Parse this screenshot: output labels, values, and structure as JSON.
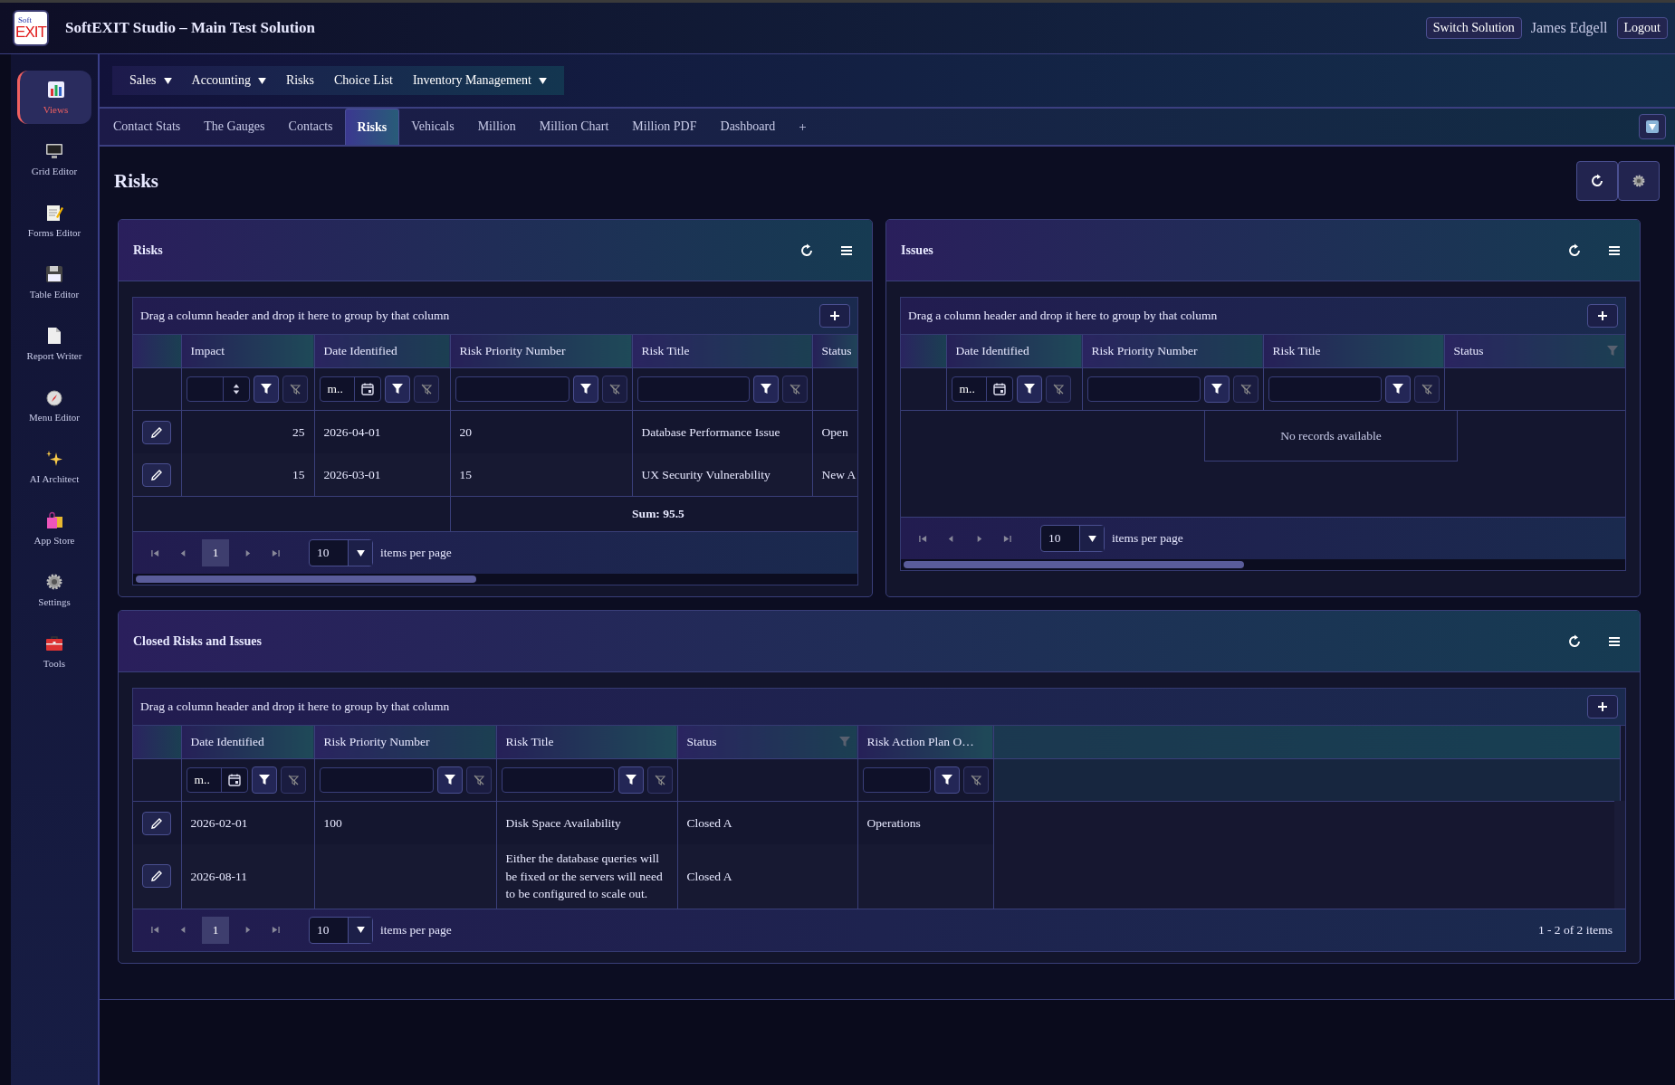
{
  "header": {
    "logo": {
      "top": "Soft",
      "bottom": "EXIT"
    },
    "title": "SoftEXIT Studio – Main Test Solution",
    "switch_button": "Switch Solution",
    "user": "James Edgell",
    "logout_button": "Logout"
  },
  "sidebar": {
    "items": [
      {
        "label": "Views",
        "selected": true
      },
      {
        "label": "Grid Editor",
        "selected": false
      },
      {
        "label": "Forms Editor",
        "selected": false
      },
      {
        "label": "Table Editor",
        "selected": false
      },
      {
        "label": "Report Writer",
        "selected": false
      },
      {
        "label": "Menu Editor",
        "selected": false
      },
      {
        "label": "AI Architect",
        "selected": false
      },
      {
        "label": "App Store",
        "selected": false
      },
      {
        "label": "Settings",
        "selected": false
      },
      {
        "label": "Tools",
        "selected": false
      }
    ]
  },
  "menu": {
    "items": [
      {
        "label": "Sales",
        "has_submenu": true
      },
      {
        "label": "Accounting",
        "has_submenu": true
      },
      {
        "label": "Risks",
        "has_submenu": false
      },
      {
        "label": "Choice List",
        "has_submenu": false
      },
      {
        "label": "Inventory Management",
        "has_submenu": true
      }
    ]
  },
  "tabs": {
    "items": [
      {
        "label": "Contact Stats",
        "selected": false
      },
      {
        "label": "The Gauges",
        "selected": false
      },
      {
        "label": "Contacts",
        "selected": false
      },
      {
        "label": "Risks",
        "selected": true
      },
      {
        "label": "Vehicals",
        "selected": false
      },
      {
        "label": "Million",
        "selected": false
      },
      {
        "label": "Million Chart",
        "selected": false
      },
      {
        "label": "Million PDF",
        "selected": false
      },
      {
        "label": "Dashboard",
        "selected": false
      }
    ],
    "add": "+"
  },
  "page": {
    "title": "Risks"
  },
  "panels": [
    {
      "title": "Risks",
      "grid": {
        "group_hint": "Drag a column header and drop it here to group by that column",
        "columns": [
          {
            "label": "Impact",
            "kind": "number",
            "filter_indicator": false
          },
          {
            "label": "Date Identified",
            "kind": "date",
            "placeholder": "m..",
            "filter_indicator": false
          },
          {
            "label": "Risk Priority Number",
            "kind": "text",
            "filter_indicator": false
          },
          {
            "label": "Risk Title",
            "kind": "text",
            "filter_indicator": false
          },
          {
            "label": "Status",
            "kind": "none",
            "filter_indicator": false
          }
        ],
        "rows": [
          {
            "cells": [
              "25",
              "2026-04-01",
              "20",
              "Database Performance Issue",
              "Open"
            ]
          },
          {
            "cells": [
              "15",
              "2026-03-01",
              "15",
              "UX Security Vulnerability",
              "New A"
            ]
          }
        ],
        "summary": "Sum: 95.5",
        "pager": {
          "page": "1",
          "page_size": "10",
          "per_page_label": "items per page"
        },
        "scrollbar": true
      }
    },
    {
      "title": "Issues",
      "grid": {
        "group_hint": "Drag a column header and drop it here to group by that column",
        "columns": [
          {
            "label": "Date Identified",
            "kind": "date",
            "placeholder": "m..",
            "filter_indicator": false
          },
          {
            "label": "Risk Priority Number",
            "kind": "text",
            "filter_indicator": false
          },
          {
            "label": "Risk Title",
            "kind": "text",
            "filter_indicator": false
          },
          {
            "label": "Status",
            "kind": "none",
            "filter_indicator": true
          }
        ],
        "empty_message": "No records available",
        "pager": {
          "page_size": "10",
          "per_page_label": "items per page"
        },
        "scrollbar": true
      }
    },
    {
      "title": "Closed Risks and Issues",
      "grid": {
        "group_hint": "Drag a column header and drop it here to group by that column",
        "columns": [
          {
            "label": "Date Identified",
            "kind": "date",
            "placeholder": "m..",
            "filter_indicator": false
          },
          {
            "label": "Risk Priority Number",
            "kind": "text",
            "filter_indicator": false
          },
          {
            "label": "Risk Title",
            "kind": "text",
            "filter_indicator": false
          },
          {
            "label": "Status",
            "kind": "none",
            "filter_indicator": true
          },
          {
            "label": "Risk Action Plan O…",
            "kind": "text",
            "filter_indicator": false
          }
        ],
        "rows": [
          {
            "cells": [
              "2026-02-01",
              "100",
              "Disk Space Availability",
              "Closed A",
              "Operations"
            ]
          },
          {
            "cells": [
              "2026-08-11",
              null,
              "Either the database queries will be fixed or the servers will need to be configured to scale out.",
              "Closed A",
              null
            ]
          }
        ],
        "pager": {
          "page": "1",
          "page_size": "10",
          "per_page_label": "items per page",
          "info": "1 - 2 of 2 items"
        },
        "scrollbar": false
      }
    }
  ]
}
